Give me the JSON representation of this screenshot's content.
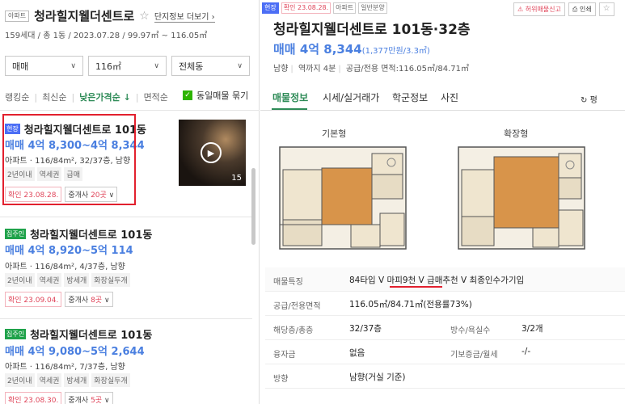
{
  "left": {
    "complex_type": "아파트",
    "complex_name": "청라힐지웰더센트로",
    "star": "☆",
    "more_link": "단지정보 더보기",
    "summary": "159세대 / 총 1동 / 2023.07.28 / 99.97㎡ ~ 116.05㎡",
    "filters": [
      {
        "value": "매매"
      },
      {
        "value": "116㎡"
      },
      {
        "value": "전체동"
      }
    ],
    "sorts": [
      "랭킹순",
      "최신순",
      "낮은가격순 ↓",
      "면적순"
    ],
    "same_listing": "동일매물 묶기",
    "items": [
      {
        "badge": "현장",
        "name": "청라힐지웰더센트로 101동",
        "price": "매매 4억 8,300~4억 8,344",
        "spec": "아파트 · 116/84m², 32/37층, 남향",
        "tags": [
          "2년이내",
          "역세권",
          "급매"
        ],
        "confirm": "확인 23.08.28.",
        "agent_prefix": "중개사 ",
        "agent_count": "20곳",
        "photo_count": "15"
      },
      {
        "badge": "집주인",
        "name": "청라힐지웰더센트로 101동",
        "price": "매매 4억 8,920~5억 114",
        "spec": "아파트 · 116/84m², 4/37층, 남향",
        "tags": [
          "2년이내",
          "역세권",
          "방세개",
          "화장실두개"
        ],
        "confirm": "확인 23.09.04.",
        "agent_prefix": "중개사 ",
        "agent_count": "8곳"
      },
      {
        "badge": "집주인",
        "name": "청라힐지웰더센트로 101동",
        "price": "매매 4억 9,080~5억 2,644",
        "spec": "아파트 · 116/84m², 7/37층, 남향",
        "tags": [
          "2년이내",
          "역세권",
          "방세개",
          "화장실두개"
        ],
        "confirm": "확인 23.08.30.",
        "agent_prefix": "중개사 ",
        "agent_count": "5곳"
      }
    ]
  },
  "right": {
    "tags": [
      "현장",
      "확인 23.08.28.",
      "아파트",
      "일반분양"
    ],
    "report": "허위매물신고",
    "print": "인쇄",
    "title": "청라힐지웰더센트로 101동·32층",
    "price": "매매 4억 8,344",
    "price_per": "(1,377만원/3.3㎡)",
    "info": [
      "남향",
      "역까지 4분",
      "공급/전용 면적:116.05㎡/84.71㎡"
    ],
    "tabs": [
      "매물정보",
      "시세/실거래가",
      "학군정보",
      "사진"
    ],
    "refresh": "평",
    "floorplans": [
      "기본형",
      "확장형"
    ],
    "table": [
      {
        "k": "매물특징",
        "v": "84타입 V 마피9천 V 급매추천 V 최종인수가기입"
      },
      {
        "k": "공급/전용면적",
        "v": "116.05㎡/84.71㎡(전용률73%)"
      },
      {
        "k": "해당층/총층",
        "v": "32/37층",
        "k2": "방수/욕실수",
        "v2": "3/2개"
      },
      {
        "k": "융자금",
        "v": "없음",
        "k2": "기보증금/월세",
        "v2": "-/-"
      },
      {
        "k": "방향",
        "v": "남향(거실 기준)"
      }
    ]
  },
  "colors": {
    "accent_green": "#2e8b57",
    "price_blue": "#4a7fe0",
    "alert_red": "#e2202e"
  }
}
